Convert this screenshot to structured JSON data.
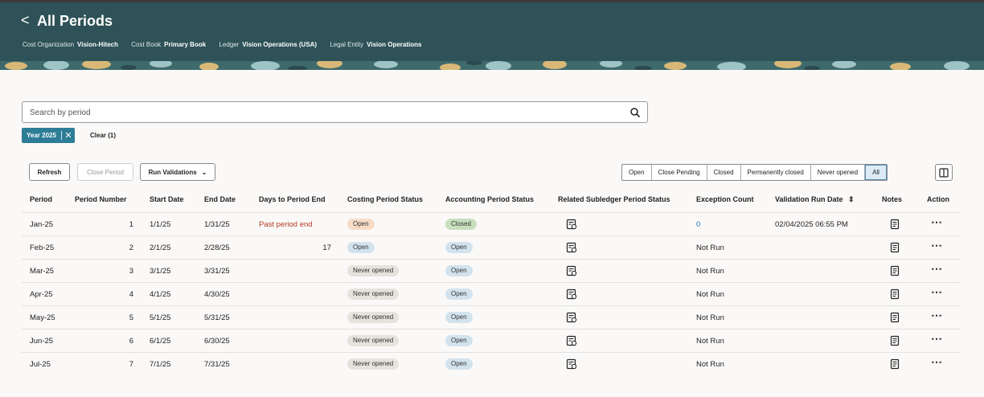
{
  "header": {
    "back_label": "<",
    "title": "All Periods",
    "context": [
      {
        "label": "Cost Organization",
        "value": "Vision-Hitech"
      },
      {
        "label": "Cost Book",
        "value": "Primary Book"
      },
      {
        "label": "Ledger",
        "value": "Vision Operations (USA)"
      },
      {
        "label": "Legal Entity",
        "value": "Vision Operations"
      }
    ]
  },
  "search": {
    "placeholder": "Search by period",
    "value": ""
  },
  "filter_chip": {
    "label": "Year 2025"
  },
  "clear_label": "Clear (1)",
  "toolbar": {
    "refresh": "Refresh",
    "close_period": "Close Period",
    "run_validations": "Run Validations"
  },
  "status_filter": {
    "options": [
      "Open",
      "Close Pending",
      "Closed",
      "Permanently closed",
      "Never opened",
      "All"
    ],
    "selected": "All"
  },
  "columns": [
    "Period",
    "Period Number",
    "Start Date",
    "End Date",
    "Days to Period End",
    "Costing Period Status",
    "Accounting Period Status",
    "Related Subledger Period Status",
    "Exception Count",
    "Validation Run Date",
    "Notes",
    "Action"
  ],
  "rows": [
    {
      "period": "Jan-25",
      "number": "1",
      "start": "1/1/25",
      "end": "1/31/25",
      "days": "Past period end",
      "costing": "Open",
      "accounting": "Closed",
      "exceptions": "0",
      "run_date": "02/04/2025 06:55 PM"
    },
    {
      "period": "Feb-25",
      "number": "2",
      "start": "2/1/25",
      "end": "2/28/25",
      "days": "17",
      "costing": "Open",
      "accounting": "Open",
      "exceptions": "Not Run",
      "run_date": ""
    },
    {
      "period": "Mar-25",
      "number": "3",
      "start": "3/1/25",
      "end": "3/31/25",
      "days": "",
      "costing": "Never opened",
      "accounting": "Open",
      "exceptions": "Not Run",
      "run_date": ""
    },
    {
      "period": "Apr-25",
      "number": "4",
      "start": "4/1/25",
      "end": "4/30/25",
      "days": "",
      "costing": "Never opened",
      "accounting": "Open",
      "exceptions": "Not Run",
      "run_date": ""
    },
    {
      "period": "May-25",
      "number": "5",
      "start": "5/1/25",
      "end": "5/31/25",
      "days": "",
      "costing": "Never opened",
      "accounting": "Open",
      "exceptions": "Not Run",
      "run_date": ""
    },
    {
      "period": "Jun-25",
      "number": "6",
      "start": "6/1/25",
      "end": "6/30/25",
      "days": "",
      "costing": "Never opened",
      "accounting": "Open",
      "exceptions": "Not Run",
      "run_date": ""
    },
    {
      "period": "Jul-25",
      "number": "7",
      "start": "7/1/25",
      "end": "7/31/25",
      "days": "",
      "costing": "Never opened",
      "accounting": "Open",
      "exceptions": "Not Run",
      "run_date": ""
    }
  ],
  "colors": {
    "header_bg": "#2e5257",
    "chip_bg": "#2e7d97",
    "link": "#1f6fa8",
    "warning_text": "#b03a20"
  }
}
